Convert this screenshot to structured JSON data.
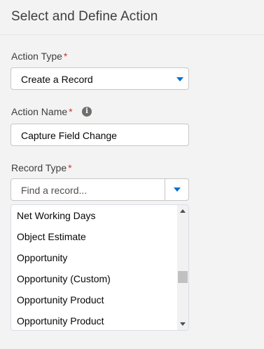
{
  "header": {
    "title": "Select and Define Action"
  },
  "action_type": {
    "label": "Action Type",
    "required_marker": "*",
    "selected_value": "Create a Record"
  },
  "action_name": {
    "label": "Action Name",
    "required_marker": "*",
    "info_icon": "info-icon",
    "value": "Capture Field Change"
  },
  "record_type": {
    "label": "Record Type",
    "required_marker": "*",
    "placeholder": "Find a record...",
    "options": [
      "Net Working Days",
      "Object Estimate",
      "Opportunity",
      "Opportunity (Custom)",
      "Opportunity Product",
      "Opportunity Product"
    ]
  },
  "colors": {
    "accent": "#0070d2",
    "required": "#c23934",
    "background": "#f3f3f4"
  }
}
